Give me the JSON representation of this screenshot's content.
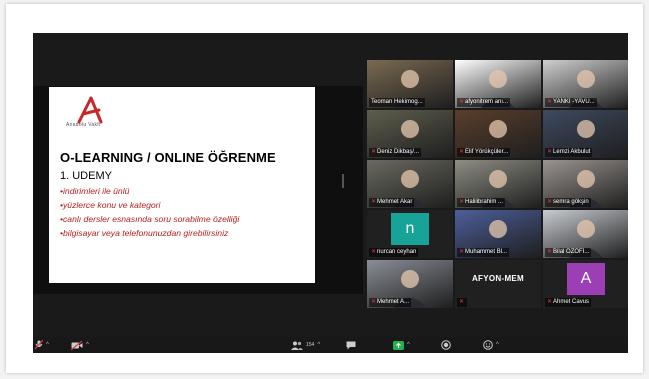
{
  "slide": {
    "logo_text": "Anadolu Vakfı",
    "title": "O-LEARNING / ONLINE ÖĞRENME",
    "subtitle": "1. UDEMY",
    "bullets": [
      "•indirimleri ile ünlü",
      "•yüzlerce konu ve kategori",
      "•canlı dersler esnasında soru sorabilme özelliği",
      "•bilgisayar veya telefonunuzdan girebilirsiniz"
    ]
  },
  "participants": [
    {
      "name": "Teoman Hekimog...",
      "mic_muted": false,
      "active": true,
      "avatar": "video",
      "color": "#7a6a52"
    },
    {
      "name": "afyonitrem anı...",
      "mic_muted": true,
      "active": false,
      "avatar": "video-logo",
      "color": "#ffffff"
    },
    {
      "name": "YANKI -YAVU...",
      "mic_muted": true,
      "active": false,
      "avatar": "video",
      "color": "#cfcfcf"
    },
    {
      "name": "Deniz Dikbaş/...",
      "mic_muted": true,
      "active": false,
      "avatar": "video",
      "color": "#5e5e4e"
    },
    {
      "name": "Elif Yörükçüler...",
      "mic_muted": true,
      "active": false,
      "avatar": "video",
      "color": "#5a3e2c"
    },
    {
      "name": "Lemzi Akbulut",
      "mic_muted": true,
      "active": false,
      "avatar": "video",
      "color": "#3e4a60"
    },
    {
      "name": "Mehmet Akar",
      "mic_muted": true,
      "active": false,
      "avatar": "video",
      "color": "#6a6a60"
    },
    {
      "name": "Halilibrahim ...",
      "mic_muted": true,
      "active": false,
      "avatar": "video",
      "color": "#8e8e84"
    },
    {
      "name": "semra gökşin",
      "mic_muted": true,
      "active": false,
      "avatar": "video",
      "color": "#9a9490"
    },
    {
      "name": "nurcan ceyhan",
      "mic_muted": true,
      "active": false,
      "avatar": "letter",
      "letter": "n",
      "color": "#17a398"
    },
    {
      "name": "Muhammet Bl...",
      "mic_muted": true,
      "active": false,
      "avatar": "video",
      "color": "#4c5f9a"
    },
    {
      "name": "Bilal ÖZÖFİ...",
      "mic_muted": true,
      "active": false,
      "avatar": "video",
      "color": "#c8ccd2"
    },
    {
      "name": "Mehmet A...",
      "mic_muted": true,
      "active": false,
      "avatar": "video",
      "color": "#8a8e96"
    },
    {
      "name": "",
      "mic_muted": true,
      "active": false,
      "avatar": "text",
      "text": "AFYON-MEM",
      "color": "#222222"
    },
    {
      "name": "Ahmet Cavus",
      "mic_muted": true,
      "active": false,
      "avatar": "letter",
      "letter": "A",
      "color": "#9c3fb4"
    }
  ],
  "toolbar": {
    "participants_count": "154"
  },
  "colors": {
    "active_speaker": "#b9e13a",
    "muted_mic": "#e23c3c",
    "share_green": "#22b14c",
    "slide_bullet": "#b61f1f"
  },
  "icons": {
    "mic": "mic-muted-icon",
    "video": "video-off-icon",
    "participants": "participants-icon",
    "chat": "chat-icon",
    "share": "share-screen-icon",
    "record": "record-icon",
    "reactions": "reactions-icon",
    "next": "chevron-down-icon"
  }
}
